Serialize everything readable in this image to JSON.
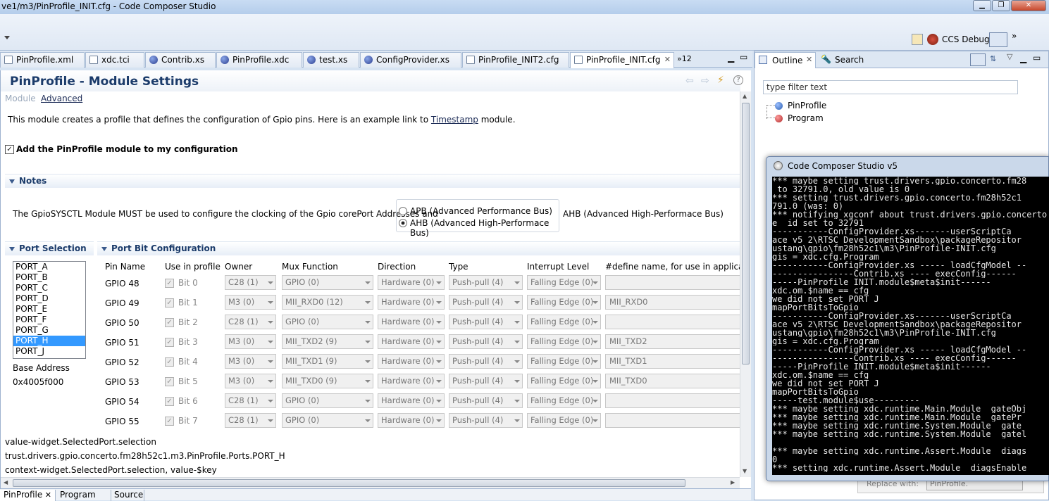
{
  "window": {
    "title": "ve1/m3/PinProfile_INIT.cfg - Code Composer Studio"
  },
  "toolbar": {
    "perspective_label": "CCS Debug",
    "more": "»"
  },
  "editor_tabs": [
    {
      "label": "PinProfile.xml"
    },
    {
      "label": "xdc.tci"
    },
    {
      "label": "Contrib.xs"
    },
    {
      "label": "PinProfile.xdc"
    },
    {
      "label": "test.xs"
    },
    {
      "label": "ConfigProvider.xs"
    },
    {
      "label": "PinProfile_INIT2.cfg"
    },
    {
      "label": "PinProfile_INIT.cfg",
      "active": true
    }
  ],
  "editor_overflow": {
    "label": "»12"
  },
  "module": {
    "header": "PinProfile - Module Settings",
    "links": {
      "module": "Module",
      "advanced": "Advanced"
    },
    "description_pre": "This module creates a profile that defines the configuration of Gpio pins. Here is an example link to ",
    "description_link": "Timestamp",
    "description_post": " module.",
    "add_checkbox_label": "Add the PinProfile module to my configuration"
  },
  "notes": {
    "header": "Notes",
    "text": "The GpioSYSCTL Module MUST be used to configure the clocking of the Gpio corePort Addresses and",
    "radio_apb": "APB (Advanced Performance Bus)",
    "radio_ahb": "AHB (Advanced High-Performace Bus)",
    "after_text": "AHB (Advanced High-Performace Bus)",
    "selected": "AHB"
  },
  "port_selection": {
    "header": "Port Selection",
    "ports": [
      "PORT_A",
      "PORT_B",
      "PORT_C",
      "PORT_D",
      "PORT_E",
      "PORT_F",
      "PORT_G",
      "PORT_H",
      "PORT_J"
    ],
    "selected": "PORT_H",
    "base_address_label": "Base Address",
    "base_address_value": "0x4005f000"
  },
  "port_bit_config": {
    "header": "Port Bit Configuration",
    "columns": [
      "Pin Name",
      "Use in profile",
      "Owner",
      "Mux Function",
      "Direction",
      "Type",
      "Interrupt Level",
      "#define name, for use in application"
    ],
    "rows": [
      {
        "pin": "GPIO 48",
        "bit": "Bit 0",
        "owner": "C28 (1)",
        "mux": "GPIO (0)",
        "direction": "Hardware (0)",
        "type": "Push-pull (4)",
        "interrupt": "Falling Edge (0)",
        "define": ""
      },
      {
        "pin": "GPIO 49",
        "bit": "Bit 1",
        "owner": "M3  (0)",
        "mux": "MII_RXD0 (12)",
        "direction": "Hardware (0)",
        "type": "Push-pull (4)",
        "interrupt": "Falling Edge (0)",
        "define": "MII_RXD0"
      },
      {
        "pin": "GPIO 50",
        "bit": "Bit 2",
        "owner": "C28 (1)",
        "mux": "GPIO (0)",
        "direction": "Hardware (0)",
        "type": "Push-pull (4)",
        "interrupt": "Falling Edge (0)",
        "define": ""
      },
      {
        "pin": "GPIO 51",
        "bit": "Bit 3",
        "owner": "M3  (0)",
        "mux": "MII_TXD2 (9)",
        "direction": "Hardware (0)",
        "type": "Push-pull (4)",
        "interrupt": "Falling Edge (0)",
        "define": "MII_TXD2"
      },
      {
        "pin": "GPIO 52",
        "bit": "Bit 4",
        "owner": "M3  (0)",
        "mux": "MII_TXD1 (9)",
        "direction": "Hardware (0)",
        "type": "Push-pull (4)",
        "interrupt": "Falling Edge (0)",
        "define": "MII_TXD1"
      },
      {
        "pin": "GPIO 53",
        "bit": "Bit 5",
        "owner": "M3  (0)",
        "mux": "MII_TXD0 (9)",
        "direction": "Hardware (0)",
        "type": "Push-pull (4)",
        "interrupt": "Falling Edge (0)",
        "define": "MII_TXD0"
      },
      {
        "pin": "GPIO 54",
        "bit": "Bit 6",
        "owner": "C28 (1)",
        "mux": "GPIO (0)",
        "direction": "Hardware (0)",
        "type": "Push-pull (4)",
        "interrupt": "Falling Edge (0)",
        "define": ""
      },
      {
        "pin": "GPIO 55",
        "bit": "Bit 7",
        "owner": "C28 (1)",
        "mux": "GPIO (0)",
        "direction": "Hardware (0)",
        "type": "Push-pull (4)",
        "interrupt": "Falling Edge (0)",
        "define": ""
      }
    ]
  },
  "debug_lines": [
    "value-widget.SelectedPort.selection",
    "trust.drivers.gpio.concerto.fm28h52c1.m3.PinProfile.Ports.PORT_H",
    "context-widget.SelectedPort.selection, value-$key"
  ],
  "bottom_tabs": [
    "PinProfile",
    "Program",
    "Source"
  ],
  "outline": {
    "tab_label": "Outline",
    "search_tab_label": "Search",
    "filter_placeholder": "type filter text",
    "items": [
      {
        "label": "PinProfile",
        "color": "#3a6fc0"
      },
      {
        "label": "Program",
        "color": "#c03a3a"
      }
    ],
    "replace_with_label": "Replace with:",
    "replace_with_value": "PinProfile."
  },
  "console": {
    "title": "Code Composer Studio v5",
    "lines": [
      "*** maybe setting trust.drivers.gpio.concerto.fm28",
      " to 32791.0, old value is 0",
      "*** setting trust.drivers.gpio.concerto.fm28h52c1",
      "791.0 (was: 0)",
      "*** notifying xgconf about trust.drivers.gpio.concerto",
      "e__id set to 32791",
      "-----------ConfigProvider.xs-------userScriptCa",
      "ace_v5_2\\RTSC_DevelopmentSandbox\\packageRepositor",
      "ustang\\gpio\\fm28h52c1\\m3\\PinProfile-INIT.cfg",
      "gis = xdc.cfg.Program",
      "-----------ConfigProvider.xs ----- loadCfgModel --",
      "----------------Contrib.xs ---- execConfig------",
      "-----PinProfile_INIT.module$meta$init------",
      "xdc.om.$name == cfg",
      "we did not set PORT_J",
      "mapPortBitsToGpio",
      "-----------ConfigProvider.xs-------userScriptCa",
      "ace_v5_2\\RTSC_DevelopmentSandbox\\packageRepositor",
      "ustang\\gpio\\fm28h52c1\\m3\\PinProfile-INIT.cfg",
      "gis = xdc.cfg.Program",
      "-----------ConfigProvider.xs ----- loadCfgModel --",
      "----------------Contrib.xs ---- execConfig------",
      "-----PinProfile_INIT.module$meta$init------",
      "xdc.om.$name == cfg",
      "we did not set PORT_J",
      "mapPortBitsToGpio",
      "-----test.module$use---------",
      "*** maybe setting xdc.runtime.Main.Module__gateObj",
      "*** maybe setting xdc.runtime.Main.Module__gatePr",
      "*** maybe setting xdc.runtime.System.Module__gate",
      "*** maybe setting xdc.runtime.System.Module__gatel",
      "",
      "*** maybe setting xdc.runtime.Assert.Module__diags",
      "0",
      "*** setting xdc.runtime.Assert.Module__diagsEnable"
    ]
  }
}
